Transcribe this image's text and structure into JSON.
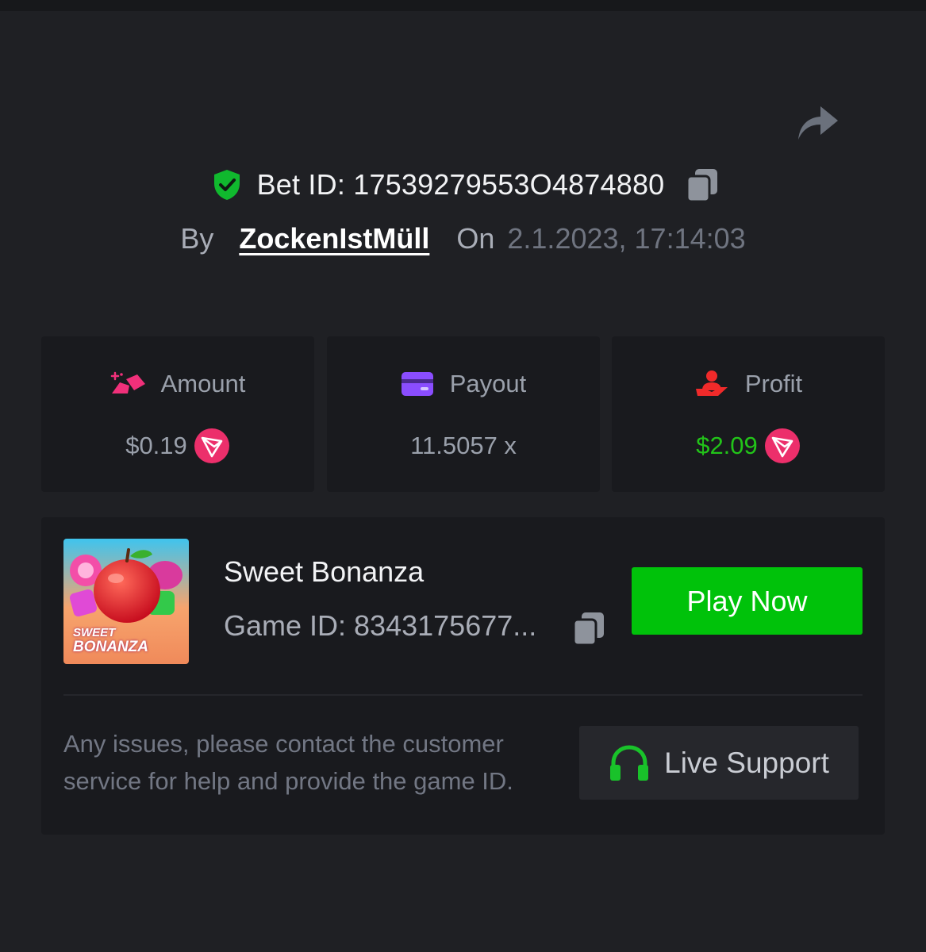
{
  "header": {
    "bet_id": "Bet ID: 17539279553O4874880",
    "by_label": "By",
    "username": "ZockenIstMüll",
    "on_label": "On",
    "datetime": "2.1.2023, 17:14:03"
  },
  "stats": {
    "amount": {
      "title": "Amount",
      "value": "$0.19",
      "icon": "amount-icon"
    },
    "payout": {
      "title": "Payout",
      "value": "11.5057 x",
      "icon": "wallet-icon"
    },
    "profit": {
      "title": "Profit",
      "value": "$2.09",
      "icon": "profit-hand-icon"
    }
  },
  "game": {
    "name": "Sweet Bonanza",
    "game_id": "Game ID: 8343175677...",
    "thumb_text_1": "SWEET",
    "thumb_text_2": "BONANZA",
    "play_label": "Play Now"
  },
  "support": {
    "text": "Any issues, please contact the customer service for help and provide the game ID.",
    "button_label": "Live Support"
  },
  "colors": {
    "background": "#1f2024",
    "card": "#191a1e",
    "accent_green": "#00c20a",
    "profit_green": "#22c419",
    "tron_pink": "#ec2f6b"
  }
}
